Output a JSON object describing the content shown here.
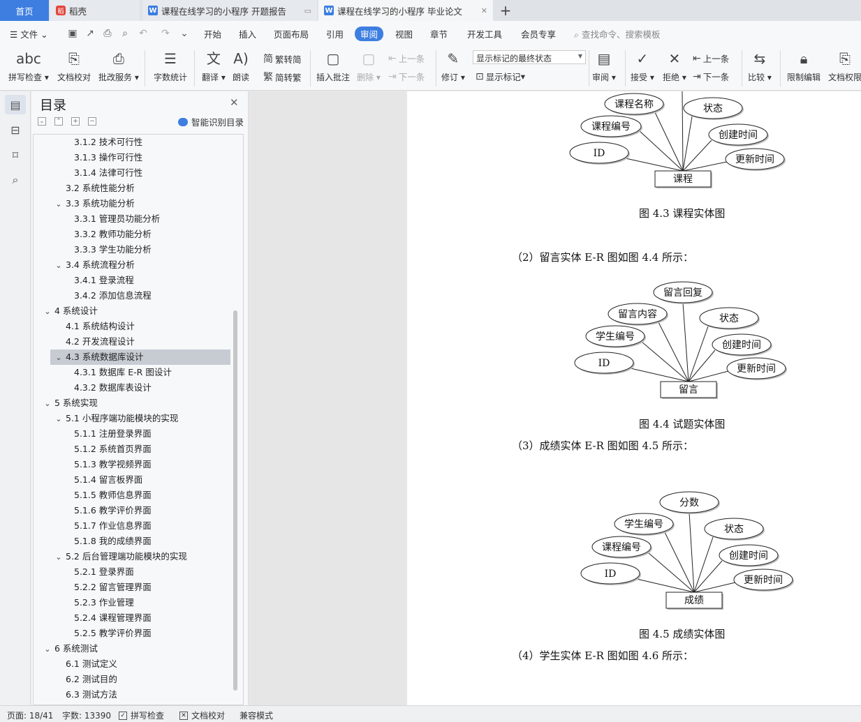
{
  "tabs": {
    "home": "首页",
    "daoke": "稻壳",
    "doc1": "课程在线学习的小程序 开题报告",
    "doc2": "课程在线学习的小程序 毕业论文"
  },
  "menu": {
    "file": "文件",
    "items": [
      "开始",
      "插入",
      "页面布局",
      "引用",
      "审阅",
      "视图",
      "章节",
      "开发工具",
      "会员专享"
    ],
    "search": "查找命令、搜索模板"
  },
  "ribbon": {
    "spell": "拼写检查",
    "doc_check": "文档校对",
    "proof_service": "批改服务",
    "word_count": "字数统计",
    "translate": "翻译",
    "read_aloud": "朗读",
    "to_traditional": "繁转简",
    "to_simplified": "简转繁",
    "insert_comment": "插入批注",
    "delete": "删除",
    "prev_comment": "上一条",
    "next_comment": "下一条",
    "track": "修订",
    "markup_state": "显示标记的最终状态",
    "show_markup": "显示标记",
    "review": "审阅",
    "accept": "接受",
    "reject": "拒绝",
    "prev_change": "上一条",
    "next_change": "下一条",
    "compare": "比较",
    "restrict_edit": "限制编辑",
    "doc_permission": "文档权限"
  },
  "toc": {
    "title": "目录",
    "smart": "智能识别目录",
    "items": [
      {
        "text": "3.1.2 技术可行性",
        "level": 3,
        "caret": ""
      },
      {
        "text": "3.1.3  操作可行性",
        "level": 3,
        "caret": ""
      },
      {
        "text": "3.1.4 法律可行性",
        "level": 3,
        "caret": ""
      },
      {
        "text": "3.2 系统性能分析",
        "level": 2,
        "caret": ""
      },
      {
        "text": "3.3 系统功能分析",
        "level": 2,
        "caret": "v"
      },
      {
        "text": "3.3.1 管理员功能分析",
        "level": 3,
        "caret": ""
      },
      {
        "text": "3.3.2 教师功能分析",
        "level": 3,
        "caret": ""
      },
      {
        "text": "3.3.3 学生功能分析",
        "level": 3,
        "caret": ""
      },
      {
        "text": "3.4 系统流程分析",
        "level": 2,
        "caret": "v"
      },
      {
        "text": "3.4.1 登录流程",
        "level": 3,
        "caret": ""
      },
      {
        "text": "3.4.2 添加信息流程",
        "level": 3,
        "caret": ""
      },
      {
        "text": "4  系统设计",
        "level": 1,
        "caret": "v"
      },
      {
        "text": "4.1 系统结构设计",
        "level": 2,
        "caret": ""
      },
      {
        "text": "4.2 开发流程设计",
        "level": 2,
        "caret": ""
      },
      {
        "text": "4.3 系统数据库设计",
        "level": 2,
        "caret": "v",
        "selected": true
      },
      {
        "text": "4.3.1  数据库 E-R 图设计",
        "level": 3,
        "caret": ""
      },
      {
        "text": "4.3.2  数据库表设计",
        "level": 3,
        "caret": ""
      },
      {
        "text": "5  系统实现",
        "level": 1,
        "caret": "v"
      },
      {
        "text": "5.1 小程序端功能模块的实现",
        "level": 2,
        "caret": "v"
      },
      {
        "text": "5.1.1 注册登录界面",
        "level": 3,
        "caret": ""
      },
      {
        "text": "5.1.2 系统首页界面",
        "level": 3,
        "caret": ""
      },
      {
        "text": "5.1.3 教学视频界面",
        "level": 3,
        "caret": ""
      },
      {
        "text": "5.1.4 留言板界面",
        "level": 3,
        "caret": ""
      },
      {
        "text": "5.1.5 教师信息界面",
        "level": 3,
        "caret": ""
      },
      {
        "text": "5.1.6 教学评价界面",
        "level": 3,
        "caret": ""
      },
      {
        "text": "5.1.7 作业信息界面",
        "level": 3,
        "caret": ""
      },
      {
        "text": "5.1.8 我的成绩界面",
        "level": 3,
        "caret": ""
      },
      {
        "text": "5.2 后台管理端功能模块的实现",
        "level": 2,
        "caret": "v"
      },
      {
        "text": "5.2.1 登录界面",
        "level": 3,
        "caret": ""
      },
      {
        "text": "5.2.2 留言管理界面",
        "level": 3,
        "caret": ""
      },
      {
        "text": "5.2.3 作业管理",
        "level": 3,
        "caret": ""
      },
      {
        "text": "5.2.4 课程管理界面",
        "level": 3,
        "caret": ""
      },
      {
        "text": "5.2.5 教学评价界面",
        "level": 3,
        "caret": ""
      },
      {
        "text": "6  系统测试",
        "level": 1,
        "caret": "v"
      },
      {
        "text": "6.1  测试定义",
        "level": 2,
        "caret": ""
      },
      {
        "text": "6.2  测试目的",
        "level": 2,
        "caret": ""
      },
      {
        "text": "6.3  测试方法",
        "level": 2,
        "caret": ""
      }
    ]
  },
  "document": {
    "fig43": {
      "entity": "课程",
      "attrs": [
        "ID",
        "课程编号",
        "课程名称",
        "状态",
        "创建时间",
        "更新时间"
      ],
      "caption": "图 4.3  课程实体图"
    },
    "para2": "（2）留言实体 E-R 图如图 4.4 所示：",
    "fig44": {
      "entity": "留言",
      "attrs": [
        "ID",
        "学生编号",
        "留言内容",
        "留言回复",
        "状态",
        "创建时间",
        "更新时间"
      ],
      "caption": "图 4.4  试题实体图"
    },
    "para3": "（3）成绩实体 E-R 图如图 4.5 所示：",
    "fig45": {
      "entity": "成绩",
      "attrs": [
        "ID",
        "课程编号",
        "学生编号",
        "分数",
        "状态",
        "创建时间",
        "更新时间"
      ],
      "caption": "图 4.5  成绩实体图"
    },
    "para4": "（4）学生实体 E-R 图如图 4.6 所示："
  },
  "status": {
    "page": "页面: 18/41",
    "words": "字数: 13390",
    "spell": "拼写检查",
    "doc_check": "文档校对",
    "compat": "兼容模式"
  }
}
